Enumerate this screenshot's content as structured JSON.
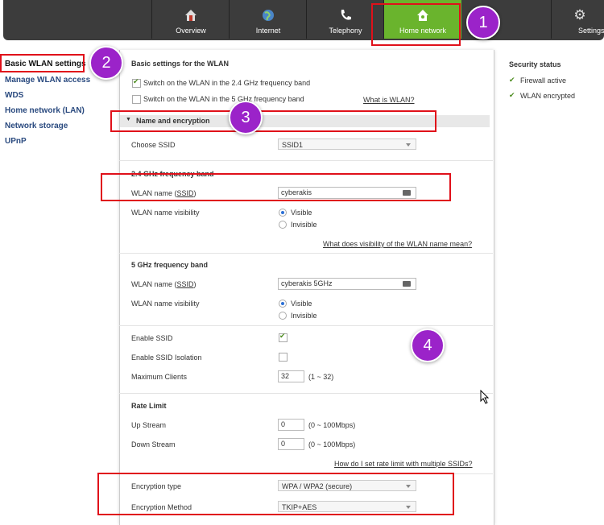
{
  "nav": {
    "tabs": [
      {
        "label": "Overview",
        "icon": "home-warning-icon"
      },
      {
        "label": "Internet",
        "icon": "globe-icon"
      },
      {
        "label": "Telephony",
        "icon": "phone-icon"
      },
      {
        "label": "Home network",
        "icon": "home-network-icon"
      },
      {
        "label": "Settings",
        "icon": "gear-icon"
      }
    ],
    "active_color": "#6ab42d"
  },
  "sidebar": {
    "items": [
      {
        "label": "Basic WLAN settings"
      },
      {
        "label": "Manage WLAN access"
      },
      {
        "label": "WDS"
      },
      {
        "label": "Home network (LAN)"
      },
      {
        "label": "Network storage"
      },
      {
        "label": "UPnP"
      }
    ]
  },
  "security": {
    "title": "Security status",
    "items": [
      "Firewall active",
      "WLAN encrypted"
    ]
  },
  "main": {
    "heading": "Basic settings for the WLAN",
    "switch_24": {
      "label": "Switch on the WLAN in the 2.4 GHz frequency band",
      "checked": true
    },
    "switch_5": {
      "label": "Switch on the WLAN in the 5 GHz frequency band",
      "checked": false
    },
    "what_is_wlan": "What is WLAN?",
    "section_title": "Name and encryption",
    "choose_ssid_label": "Choose SSID",
    "choose_ssid_value": "SSID1",
    "band24": {
      "title": "2.4 GHz frequency band",
      "name_label": "WLAN name (",
      "ssid_link": "SSID",
      "name_close": ")",
      "name_value": "cyberakis",
      "visibility_label": "WLAN name visibility",
      "visible": "Visible",
      "invisible": "Invisible"
    },
    "visibility_help": "What does visibility of the WLAN name mean?",
    "band5": {
      "title": "5 GHz frequency band",
      "name_label": "WLAN name (",
      "ssid_link": "SSID",
      "name_close": ")",
      "name_value": "cyberakis 5GHz",
      "visibility_label": "WLAN name visibility",
      "visible": "Visible",
      "invisible": "Invisible"
    },
    "enable_ssid": "Enable SSID",
    "enable_isolation": "Enable SSID Isolation",
    "max_clients_label": "Maximum Clients",
    "max_clients_value": "32",
    "max_clients_range": "(1 ~ 32)",
    "rate_limit": {
      "title": "Rate Limit",
      "up_label": "Up Stream",
      "up_value": "0",
      "up_range": "(0 ~ 100Mbps)",
      "down_label": "Down Stream",
      "down_value": "0",
      "down_range": "(0 ~ 100Mbps)",
      "help": "How do I set rate limit with multiple SSIDs?"
    },
    "encryption_type_label": "Encryption type",
    "encryption_type_value": "WPA / WPA2 (secure)",
    "encryption_method_label": "Encryption Method",
    "encryption_method_value": "TKIP+AES"
  },
  "badges": [
    "1",
    "2",
    "3",
    "4"
  ],
  "annotation_color": "#e0101a",
  "badge_color": "#9b23c9"
}
